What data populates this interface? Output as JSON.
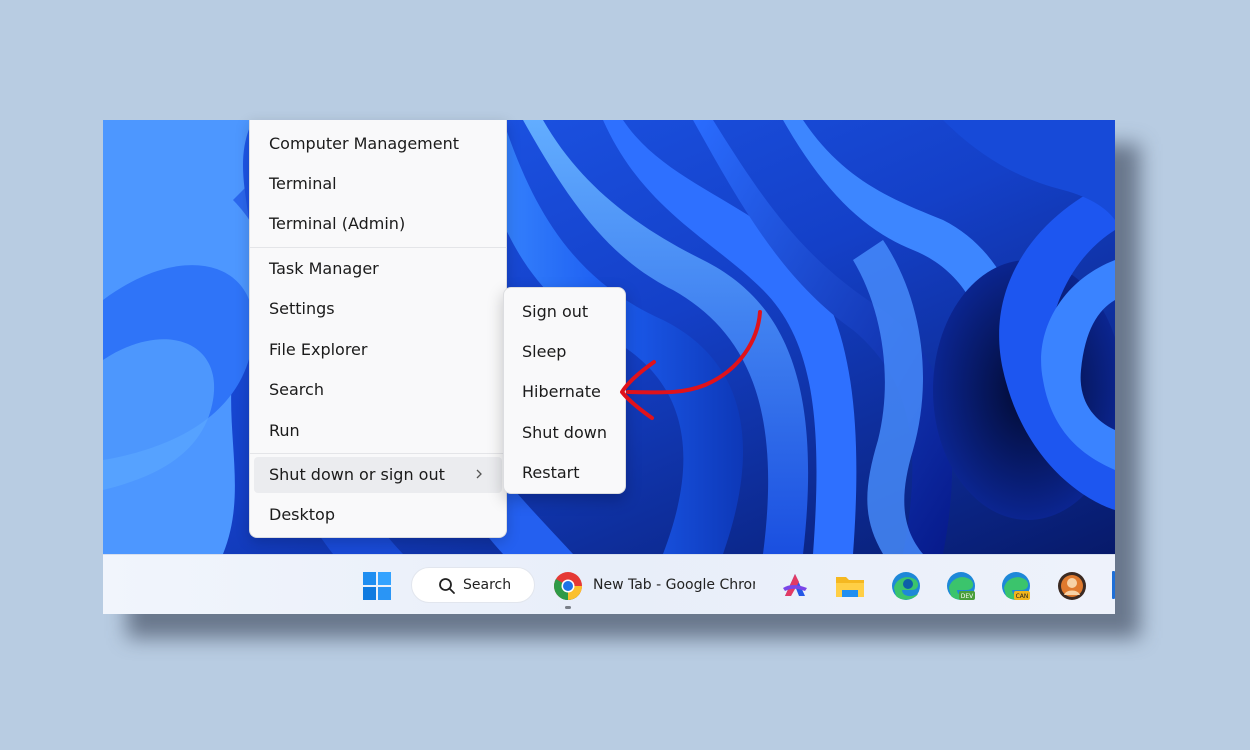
{
  "context_menu": {
    "items": [
      {
        "label": "Computer Management"
      },
      {
        "label": "Terminal"
      },
      {
        "label": "Terminal (Admin)"
      },
      {
        "label": "Task Manager"
      },
      {
        "label": "Settings"
      },
      {
        "label": "File Explorer"
      },
      {
        "label": "Search"
      },
      {
        "label": "Run"
      },
      {
        "label": "Shut down or sign out",
        "has_submenu": true,
        "highlighted": true
      },
      {
        "label": "Desktop"
      }
    ]
  },
  "submenu": {
    "items": [
      {
        "label": "Sign out"
      },
      {
        "label": "Sleep"
      },
      {
        "label": "Hibernate"
      },
      {
        "label": "Shut down"
      },
      {
        "label": "Restart"
      }
    ]
  },
  "taskbar": {
    "search_label": "Search",
    "active_app_label": "New Tab - Google Chrome",
    "pinned_icons": [
      "start-windows-icon",
      "search-icon",
      "chrome-icon",
      "copilot-icon",
      "file-explorer-icon",
      "edge-icon",
      "edge-dev-icon",
      "edge-canary-icon",
      "profile-app-icon"
    ]
  },
  "colors": {
    "background": "#b8cce2",
    "wallpaper_blue": "#1a49d8",
    "annotation_arrow": "#e0121b",
    "menu_bg": "#f9f9fa"
  }
}
